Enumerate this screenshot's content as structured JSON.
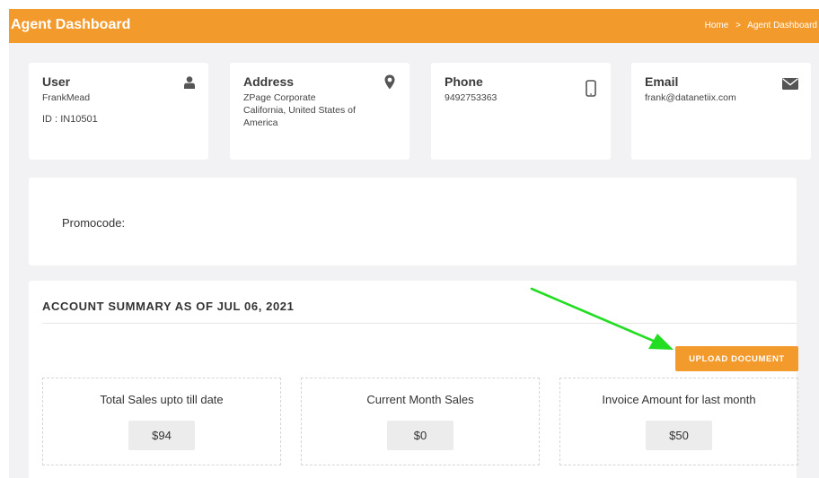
{
  "header": {
    "title": "Agent Dashboard",
    "breadcrumb": [
      {
        "label": "Home"
      },
      {
        "label": "Agent Dashboard"
      }
    ],
    "breadcrumb_separator": ">"
  },
  "cards": {
    "user": {
      "title": "User",
      "name": "FrankMead",
      "id_label": "ID :",
      "id_value": "IN10501",
      "icon": "user-icon"
    },
    "address": {
      "title": "Address",
      "line1": "ZPage Corporate",
      "line2": "California, United States of",
      "line3": "America",
      "icon": "map-marker-icon"
    },
    "phone": {
      "title": "Phone",
      "number": "9492753363",
      "icon": "mobile-phone-icon"
    },
    "email": {
      "title": "Email",
      "address": "frank@datanetiix.com",
      "icon": "envelope-icon"
    }
  },
  "promo": {
    "label": "Promocode:"
  },
  "summary": {
    "title": "ACCOUNT SUMMARY AS OF JUL 06, 2021",
    "upload_label": "UPLOAD DOCUMENT",
    "stats": [
      {
        "label": "Total Sales upto till date",
        "value": "$94"
      },
      {
        "label": "Current Month Sales",
        "value": "$0"
      },
      {
        "label": "Invoice Amount for last month",
        "value": "$50"
      }
    ]
  },
  "colors": {
    "accent": "#f39a2c",
    "background": "#f2f2f4",
    "annotation_arrow": "#22dd22"
  }
}
